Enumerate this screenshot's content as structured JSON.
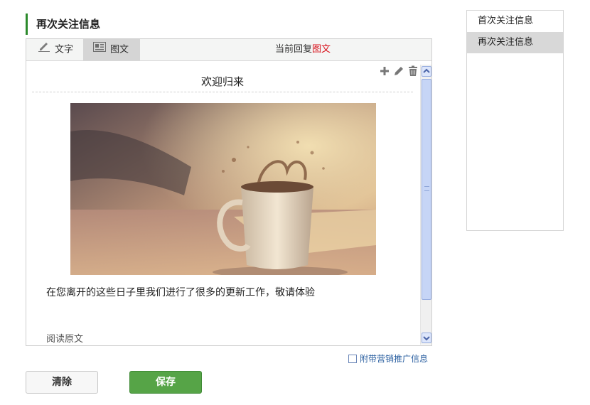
{
  "page": {
    "section_title": "再次关注信息"
  },
  "editor": {
    "tabs": [
      {
        "label": "文字",
        "icon": "pencil-icon",
        "selected": false
      },
      {
        "label": "图文",
        "icon": "news-card-icon",
        "selected": true
      }
    ],
    "reply_status_prefix": "当前回复",
    "reply_status_type": "图文",
    "reply_status_type_color": "#d8101a"
  },
  "article": {
    "title": "欢迎归来",
    "digest": "在您离开的这些日子里我们进行了很多的更新工作，敬请体验",
    "read_more": "阅读原文",
    "actions": [
      "add-icon",
      "edit-icon",
      "delete-icon"
    ]
  },
  "marketing": {
    "label": "附带营销推广信息",
    "checked": false
  },
  "buttons": {
    "clear": "清除",
    "save": "保存"
  },
  "side_panel": {
    "items": [
      {
        "label": "首次关注信息",
        "active": false
      },
      {
        "label": "再次关注信息",
        "active": true
      }
    ]
  },
  "colors": {
    "accent_green": "#56a447",
    "title_bar_green": "#2c8a2c",
    "link_blue": "#2a5fa0"
  }
}
